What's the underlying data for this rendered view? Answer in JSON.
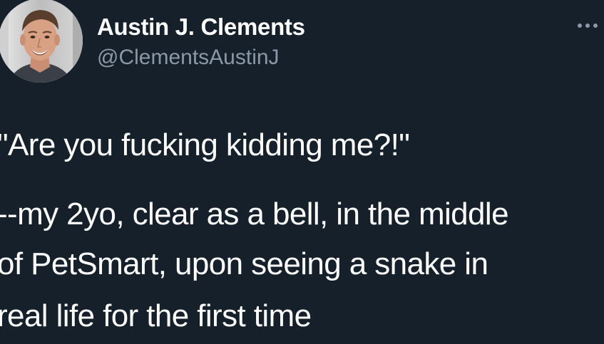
{
  "author": {
    "display_name": "Austin J. Clements",
    "handle": "@ClementsAustinJ",
    "avatar_icon": "profile-photo",
    "more_icon": "more-horizontal-icon"
  },
  "tweet": {
    "quote": "\"Are you fucking kidding me?!\"",
    "lines": [
      "--my 2yo, clear as a bell, in the middle",
      "of PetSmart, upon seeing a snake in",
      "real life for the first time"
    ]
  },
  "colors": {
    "background": "#15202b",
    "text_primary": "#ffffff",
    "text_secondary": "#8b98a5"
  }
}
